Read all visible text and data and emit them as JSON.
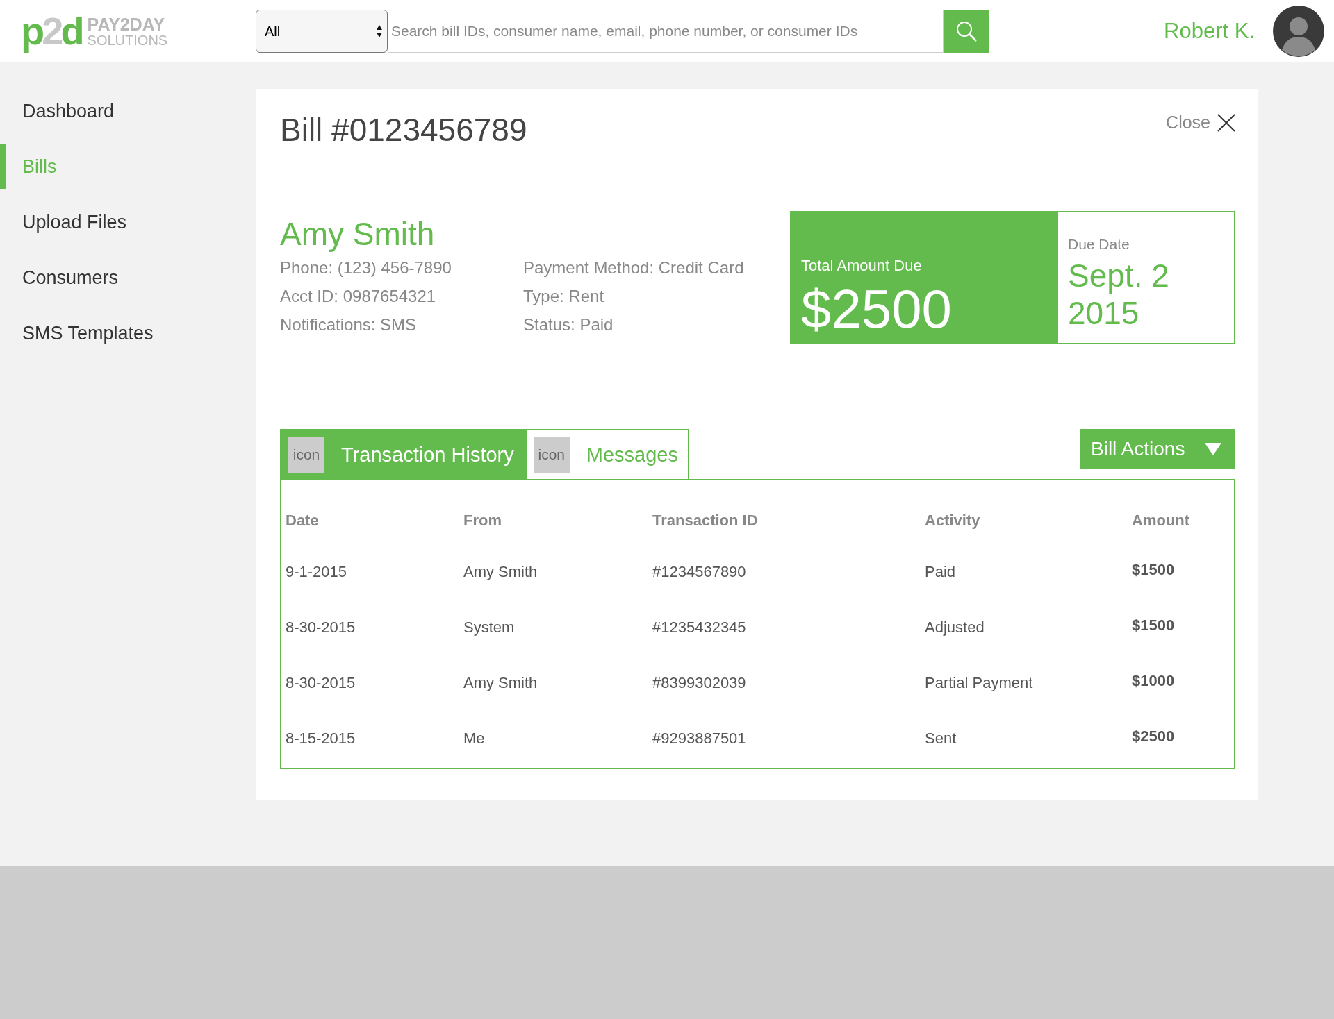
{
  "logo": {
    "mark": [
      {
        "text": "p",
        "kind": "accent"
      },
      {
        "text": "2",
        "kind": "muted"
      },
      {
        "text": "d",
        "kind": "accent"
      }
    ],
    "line_1": "PAY2DAY",
    "line_2": "SOLUTIONS"
  },
  "search": {
    "scope": "All",
    "placeholder": "Search bill IDs, consumer name, email, phone number, or consumer IDs"
  },
  "user": {
    "name": "Robert K."
  },
  "sidebar": {
    "items": [
      {
        "label": "Dashboard",
        "selected": false
      },
      {
        "label": "Bills",
        "selected": true
      },
      {
        "label": "Upload Files",
        "selected": false
      },
      {
        "label": "Consumers",
        "selected": false
      },
      {
        "label": "SMS Templates",
        "selected": false
      }
    ]
  },
  "bill": {
    "title": "Bill #0123456789",
    "close": "Close",
    "consumer": "Amy Smith",
    "details_left": [
      "Phone: (123) 456-7890",
      "Acct ID: 0987654321",
      "Notifications: SMS"
    ],
    "details_right": [
      "Payment Method: Credit Card",
      "Type: Rent",
      "Status: Paid"
    ],
    "total_label": "Total Amount Due",
    "total": "$2500",
    "due_label": "Due Date",
    "due_line_1": "Sept. 2",
    "due_line_2": "2015"
  },
  "tabs": [
    {
      "icon_label": "icon",
      "label": "Transaction History",
      "selected": true
    },
    {
      "icon_label": "icon",
      "label": "Messages",
      "selected": false
    }
  ],
  "actions_button": "Bill Actions",
  "table": {
    "columns": [
      "Date",
      "From",
      "Transaction ID",
      "Activity",
      "Amount"
    ],
    "rows": [
      [
        "9-1-2015",
        "Amy Smith",
        "#1234567890",
        "Paid",
        "$1500"
      ],
      [
        "8-30-2015",
        "System",
        "#1235432345",
        "Adjusted",
        "$1500"
      ],
      [
        "8-30-2015",
        "Amy Smith",
        "#8399302039",
        "Partial Payment",
        "$1000"
      ],
      [
        "8-15-2015",
        "Me",
        "#9293887501",
        "Sent",
        "$2500"
      ]
    ]
  }
}
